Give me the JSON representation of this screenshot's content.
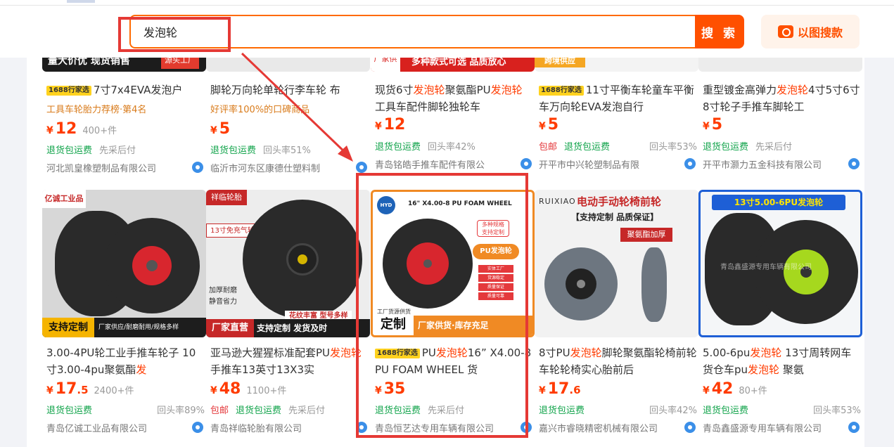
{
  "search": {
    "query": "发泡轮",
    "button": "搜 索",
    "image_search": "以图搜款"
  },
  "row1": [
    {
      "img_text": "量大价优 现货销售",
      "img_tag": "源头工厂",
      "badge": "1688行家选",
      "title": "7寸7x4EVA发泡户",
      "sub": "工具车轮胎力荐榜·第4名",
      "price_int": "12",
      "price_dec": "",
      "sold": "400+件",
      "tag1": "退货包运费",
      "tag2": "先采后付",
      "repeat": "",
      "company": "河北凯皇橡塑制品有限公司"
    },
    {
      "img_text": "",
      "img_tag": "",
      "badge": "",
      "title": "脚轮万向轮单轮行李车轮 布",
      "sub": "好评率100%的口碑商品",
      "price_int": "5",
      "price_dec": "",
      "sold": "",
      "tag1": "退货包运费",
      "tag2": "回头率51%",
      "repeat": "",
      "company": "临沂市河东区康德仕塑料制"
    },
    {
      "img_text": "多种款式可选 品质放心",
      "img_tag": "厂家供应",
      "badge": "",
      "title_parts": [
        "现货6寸",
        "发泡轮",
        "聚氨酯PU",
        "发泡轮",
        " 工具车配件脚轮独轮车"
      ],
      "price_int": "12",
      "price_dec": "",
      "sold": "",
      "tag1": "退货包运费",
      "tag2": "回头率42%",
      "repeat": "",
      "company": "青岛铭皓手推车配件有限公"
    },
    {
      "img_text": "跨境供应",
      "img_tag": "",
      "badge": "1688行家选",
      "title": "11寸平衡车轮童车平衡车万向轮EVA发泡自行",
      "sub": "",
      "price_int": "5",
      "price_dec": "",
      "sold": "",
      "tag0": "包邮",
      "tag1": "退货包运费",
      "tag2": "",
      "repeat": "回头率53%",
      "company": "开平市中兴轮塑制品有限"
    },
    {
      "img_text": "",
      "img_tag": "",
      "badge": "",
      "title_parts": [
        "重型镀金高弹力",
        "发泡轮",
        "4寸5寸6寸8寸轮子手推车脚轮工"
      ],
      "price_int": "5",
      "price_dec": "",
      "sold": "",
      "tag1": "退货包运费",
      "tag2": "先采后付",
      "repeat": "",
      "company": "开平市灏力五金科技有限公司"
    }
  ],
  "row2": [
    {
      "img_top": "亿诚工业品",
      "img_bottom": "支持定制",
      "img_bottom2": "厂家供应/耐磨耐用/规格多样",
      "title_parts": [
        "3.00-4PU轮工业手推车轮子 10寸3.00-4pu聚氨酯",
        "发"
      ],
      "price_int": "17",
      "price_dec": ".5",
      "sold": "2400+件",
      "tag1": "退货包运费",
      "tag2": "",
      "repeat": "回头率89%",
      "company": "青岛亿诚工业品有限公司"
    },
    {
      "img_top": "祥临轮胎",
      "img_bottom": "厂家直营",
      "img_bottom2": "支持定制 发货及时",
      "img_side": "13寸免充气轮",
      "img_list": [
        "加厚耐磨",
        "静音省力"
      ],
      "img_strip": "花纹丰富 型号多样",
      "title_parts": [
        "亚马逊大猩猩标准配套PU",
        "发泡轮",
        " 手推车13英寸13X3实"
      ],
      "price_int": "48",
      "price_dec": "",
      "sold": "1100+件",
      "tag0": "包邮",
      "tag1": "退货包运费",
      "tag2": "先采后付",
      "repeat": "",
      "company": "青岛祥临轮胎有限公司"
    },
    {
      "img_logo": "HYD",
      "img_head": "16\" X4.00-8 PU FOAM WHEEL",
      "img_side": [
        "多种规格",
        "支持定制"
      ],
      "img_pu": "PU发泡轮",
      "img_list": [
        "实体工厂",
        "货源稳定",
        "质量保证",
        "质量可靠"
      ],
      "img_small": "工厂货源供货",
      "img_bottom": "定制",
      "img_bottom2": "厂家供货·库存充足",
      "badge": "1688行家选",
      "title_parts": [
        "PU",
        "发泡轮",
        "16”  X4.00-8 PU FOAM WHEEL 货"
      ],
      "price_int": "35",
      "price_dec": "",
      "sold": "",
      "tag1": "退货包运费",
      "tag2": "先采后付",
      "repeat": "",
      "company": "青岛恒艺达专用车辆有限公司"
    },
    {
      "img_brand": "RUIXIAO",
      "img_head": "电动手动轮椅前轮",
      "img_sub": "【支持定制 品质保证】",
      "img_tag": "聚氨酯加厚",
      "title_parts": [
        "8寸PU",
        "发泡轮",
        "脚轮聚氨酯轮椅前轮车轮轮椅实心胎前后"
      ],
      "price_int": "17",
      "price_dec": ".6",
      "sold": "",
      "tag1": "退货包运费",
      "tag2": "",
      "repeat": "回头率42%",
      "company": "嘉兴市睿晓精密机械有限公司"
    },
    {
      "img_head": "13寸5.00-6PU发泡轮",
      "img_watermark": "青岛鑫盛源专用车辆有限公司",
      "title_parts": [
        "5.00-6pu",
        "发泡轮",
        " 13寸周转网车货仓车pu",
        "发泡轮",
        " 聚氨"
      ],
      "price_int": "42",
      "price_dec": "",
      "sold": "80+件",
      "tag1": "退货包运费",
      "tag2": "",
      "repeat": "回头率53%",
      "company": "青岛鑫盛源专用车辆有限公司"
    }
  ],
  "colors": {
    "accent": "#ff5000",
    "price": "#ff3b00",
    "green": "#10a34a",
    "highlight": "#e53935"
  }
}
